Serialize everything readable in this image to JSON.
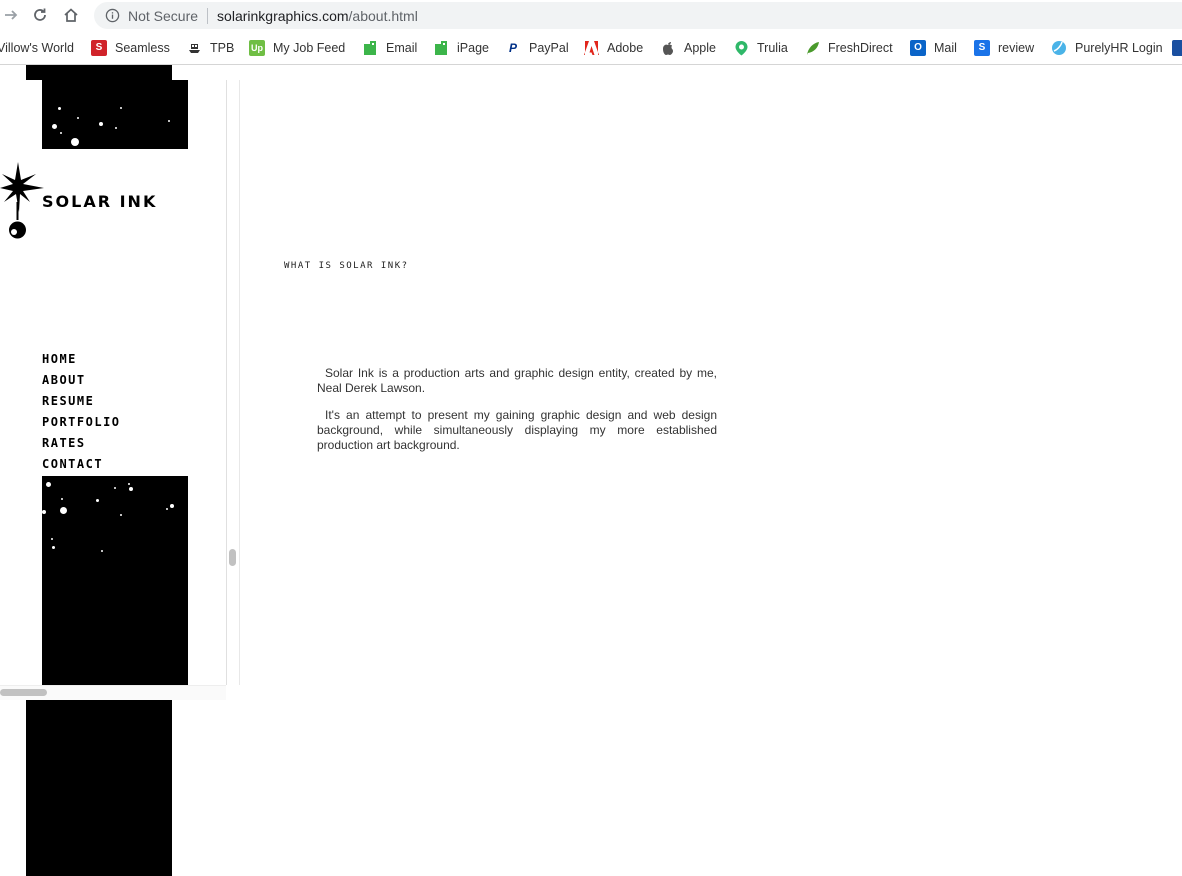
{
  "browser": {
    "security_label": "Not Secure",
    "url_host": "solarinkgraphics.com",
    "url_path": "/about.html"
  },
  "bookmarks": [
    {
      "label": "Villow's World",
      "icon": "none",
      "color": ""
    },
    {
      "label": "Seamless",
      "icon": "S",
      "color": "#d0232a"
    },
    {
      "label": "TPB",
      "icon": "ship-icon",
      "color": "#333333"
    },
    {
      "label": "My Job Feed",
      "icon": "Up",
      "color": "#6fbe44"
    },
    {
      "label": "Email",
      "icon": "page-icon",
      "color": "#3cb54a"
    },
    {
      "label": "iPage",
      "icon": "page-icon",
      "color": "#3cb54a"
    },
    {
      "label": "PayPal",
      "icon": "P",
      "color": "#003087"
    },
    {
      "label": "Adobe",
      "icon": "A",
      "color": "#e1251b"
    },
    {
      "label": "Apple",
      "icon": "apple-icon",
      "color": "#555555"
    },
    {
      "label": "Trulia",
      "icon": "pin-icon",
      "color": "#2fb869"
    },
    {
      "label": "FreshDirect",
      "icon": "leaf-icon",
      "color": "#4a9a2c"
    },
    {
      "label": "Mail",
      "icon": "O",
      "color": "#0a64c8"
    },
    {
      "label": "review",
      "icon": "S",
      "color": "#1a73e8"
    },
    {
      "label": "PurelyHR Login",
      "icon": "drop-icon",
      "color": "#4ab3e8"
    }
  ],
  "site": {
    "logo_text": "SOLAR INK",
    "nav": [
      "Home",
      "About",
      "Resume",
      "Portfolio",
      "Rates",
      "Contact"
    ],
    "heading": "What is Solar Ink?",
    "paragraphs": [
      "Solar Ink is a production arts and graphic design entity, created by me, Neal Derek Lawson.",
      "It's an attempt to present my gaining graphic design and web design background, while simultaneously displaying my more established production art background."
    ]
  }
}
